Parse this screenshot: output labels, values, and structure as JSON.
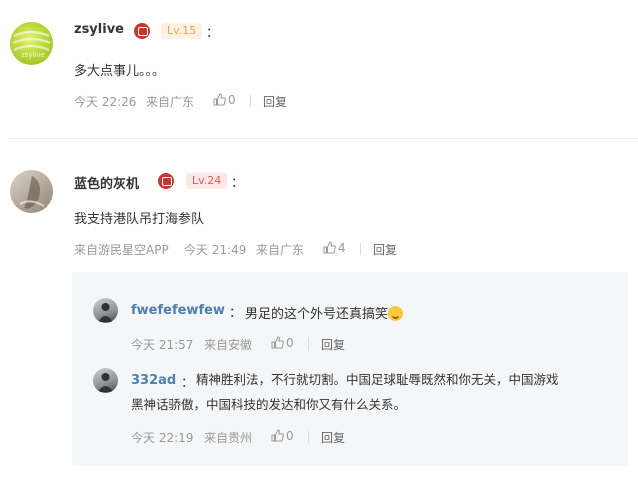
{
  "comments": [
    {
      "username": "zsylive",
      "level": "Lv.15",
      "colon": "：",
      "text": "多大点事儿。。。",
      "avatar_text": "zsylive",
      "time": "今天 22:26",
      "location": "来自广东",
      "likes": "0",
      "reply": "回复"
    },
    {
      "username": "蓝色的灰机",
      "level": "Lv.24",
      "colon": "：",
      "text": "我支持港队吊打海参队",
      "source": "来自游民星空APP",
      "time": "今天 21:49",
      "location": "来自广东",
      "likes": "4",
      "reply": "回复",
      "replies": [
        {
          "username": "fwefefewfew",
          "colon": "：",
          "text": "男足的这个外号还真搞笑",
          "emoji": "laughing-emoji",
          "time": "今天 21:57",
          "location": "来自安徽",
          "likes": "0",
          "reply": "回复"
        },
        {
          "username": "332ad",
          "colon": "：",
          "text_line1": "精神胜利法，不行就切割。中国足球耻辱既然和你无关，中国游戏",
          "text_line2": "黑神话骄傲，中国科技的发达和你又有什么关系。",
          "time": "今天 22:19",
          "location": "来自贵州",
          "likes": "0",
          "reply": "回复"
        }
      ]
    }
  ],
  "colors": {
    "level15_bg": "#fdf1e3",
    "level15_fg": "#e8a34b",
    "level24_bg": "#fde8e8",
    "level24_fg": "#e2595b",
    "reply_name": "#4e7fb1",
    "badge": "#c0392b"
  }
}
